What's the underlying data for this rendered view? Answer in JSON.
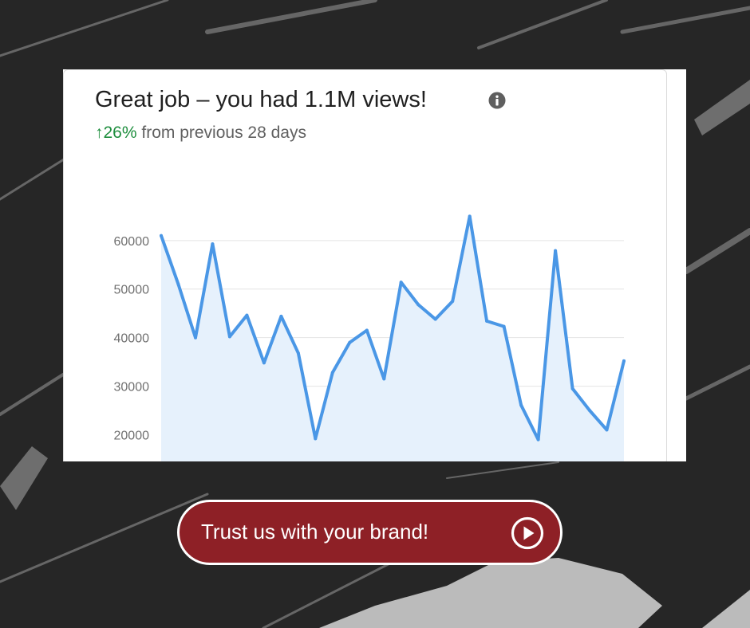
{
  "card": {
    "title": "Great job – you had 1.1M views!",
    "info_icon": "info-icon",
    "change_arrow": "↑",
    "change_value": "26%",
    "change_text": " from previous 28 days"
  },
  "cta": {
    "label": "Trust us with your brand!",
    "icon": "play-circle-icon"
  },
  "colors": {
    "background": "#262626",
    "line": "#4a97e6",
    "area_fill": "#e6f1fc",
    "positive": "#1e8e3e",
    "button": "#8e2026"
  },
  "chart_data": {
    "type": "area",
    "x": [
      1,
      2,
      3,
      4,
      5,
      6,
      7,
      8,
      9,
      10,
      11,
      12,
      13,
      14,
      15,
      16,
      17,
      18,
      19,
      20,
      21,
      22,
      23,
      24,
      25,
      26,
      27,
      28
    ],
    "series": [
      {
        "values": [
          61000,
          51000,
          40000,
          59300,
          40200,
          44600,
          34800,
          44400,
          36800,
          19200,
          32800,
          39000,
          41500,
          31500,
          51400,
          46800,
          43800,
          47500,
          65000,
          43400,
          42300,
          26100,
          19000,
          57900,
          29500,
          25000,
          21000,
          35200
        ]
      }
    ],
    "yticks": [
      "20000",
      "30000",
      "40000",
      "50000",
      "60000"
    ],
    "ylim": [
      14500,
      69000
    ],
    "grid": true,
    "legend": "none"
  }
}
